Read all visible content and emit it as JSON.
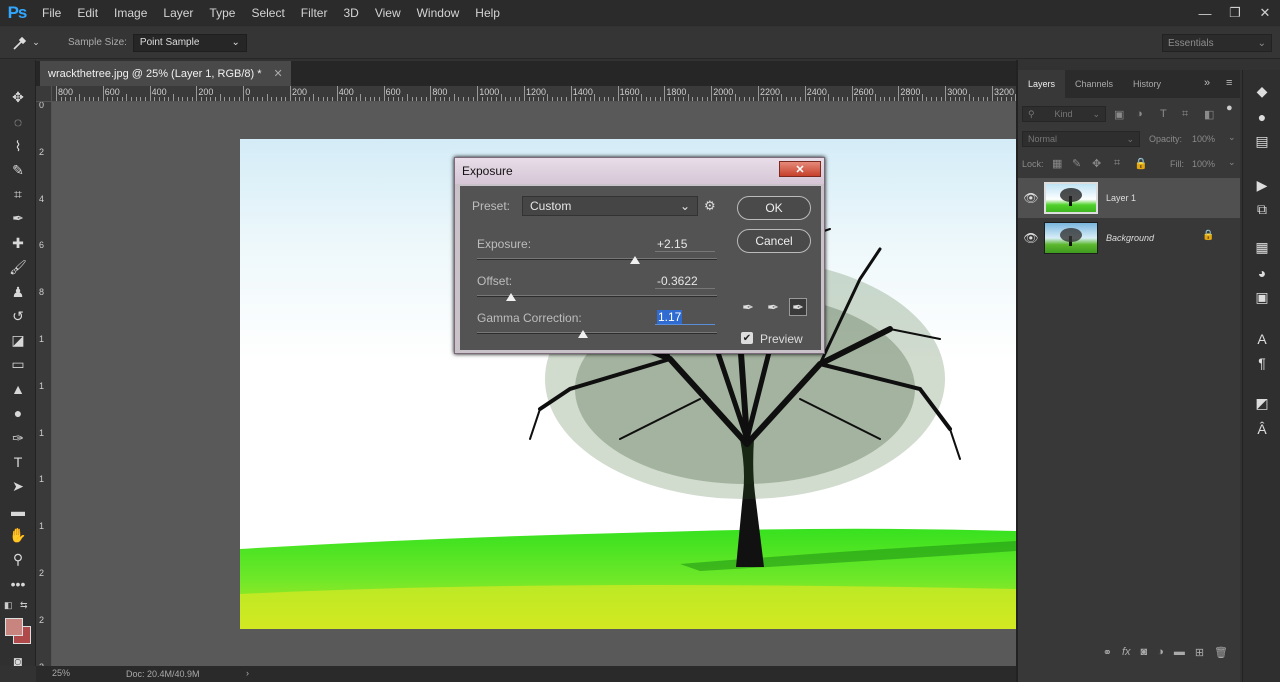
{
  "app": {
    "logo": "Ps"
  },
  "menu": [
    "File",
    "Edit",
    "Image",
    "Layer",
    "Type",
    "Select",
    "Filter",
    "3D",
    "View",
    "Window",
    "Help"
  ],
  "window_controls": [
    "—",
    "❐",
    "✕"
  ],
  "options_bar": {
    "tool_icon": "eyedropper-icon",
    "sample_size_label": "Sample Size:",
    "sample_size_value": "Point Sample",
    "workspace": "Essentials"
  },
  "document": {
    "tab_title": "wrackthetree.jpg @ 25% (Layer 1, RGB/8) *",
    "close": "✕",
    "ruler_h_labels": [
      "800",
      "600",
      "400",
      "200",
      "0",
      "200",
      "400",
      "600",
      "800",
      "1000",
      "1200",
      "1400",
      "1600",
      "1800",
      "2000",
      "2200",
      "2400",
      "2600",
      "2800",
      "3000",
      "3200"
    ],
    "ruler_v_labels": [
      "0",
      "2",
      "4",
      "6",
      "8",
      "1",
      "1",
      "1",
      "1",
      "1",
      "2",
      "2",
      "2"
    ]
  },
  "status": {
    "zoom": "25%",
    "doc": "Doc: 20.4M/40.9M",
    "arrow": "›"
  },
  "dialog": {
    "title": "Exposure",
    "close": "✕",
    "preset_label": "Preset:",
    "preset_value": "Custom",
    "ok": "OK",
    "cancel": "Cancel",
    "preview_label": "Preview",
    "preview_checked": true,
    "sliders": [
      {
        "label": "Exposure:",
        "value": "+2.15",
        "fraction": 0.66
      },
      {
        "label": "Offset:",
        "value": "-0.3622",
        "fraction": 0.14
      },
      {
        "label": "Gamma Correction:",
        "value": "1.17",
        "fraction": 0.44
      }
    ]
  },
  "layers_panel": {
    "tabs": [
      "Layers",
      "Channels",
      "History"
    ],
    "active_tab": "Layers",
    "kind_label": "Kind",
    "blend_mode": "Normal",
    "opacity_label": "Opacity:",
    "opacity_value": "100%",
    "lock_label": "Lock:",
    "fill_label": "Fill:",
    "fill_value": "100%",
    "layers": [
      {
        "name": "Layer 1",
        "selected": true,
        "locked": false
      },
      {
        "name": "Background",
        "selected": false,
        "locked": true
      }
    ]
  },
  "colors": {
    "foreground": "#c8847f",
    "background": "#b04a4a",
    "accent": "#31a8ff"
  }
}
